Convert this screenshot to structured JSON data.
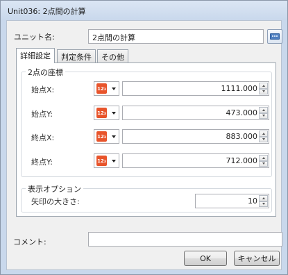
{
  "window": {
    "title": "Unit036: 2点間の計算"
  },
  "unit_name": {
    "label": "ユニット名:",
    "value": "2点間の計算",
    "icon": "keyboard-icon"
  },
  "tabs": [
    {
      "label": "詳細設定",
      "active": true
    },
    {
      "label": "判定条件",
      "active": false
    },
    {
      "label": "その他",
      "active": false
    }
  ],
  "coords_group": {
    "title": "2点の座標",
    "type_icon_text": "12₃",
    "rows": [
      {
        "label": "始点X:",
        "value": "1111.000"
      },
      {
        "label": "始点Y:",
        "value": "473.000"
      },
      {
        "label": "終点X:",
        "value": "883.000"
      },
      {
        "label": "終点Y:",
        "value": "712.000"
      }
    ]
  },
  "display_group": {
    "title": "表示オプション",
    "arrow_size_label": "矢印の大きさ:",
    "arrow_size_value": "10"
  },
  "comment": {
    "label": "コメント:",
    "value": ""
  },
  "buttons": {
    "ok": "OK",
    "cancel": "キャンセル"
  }
}
